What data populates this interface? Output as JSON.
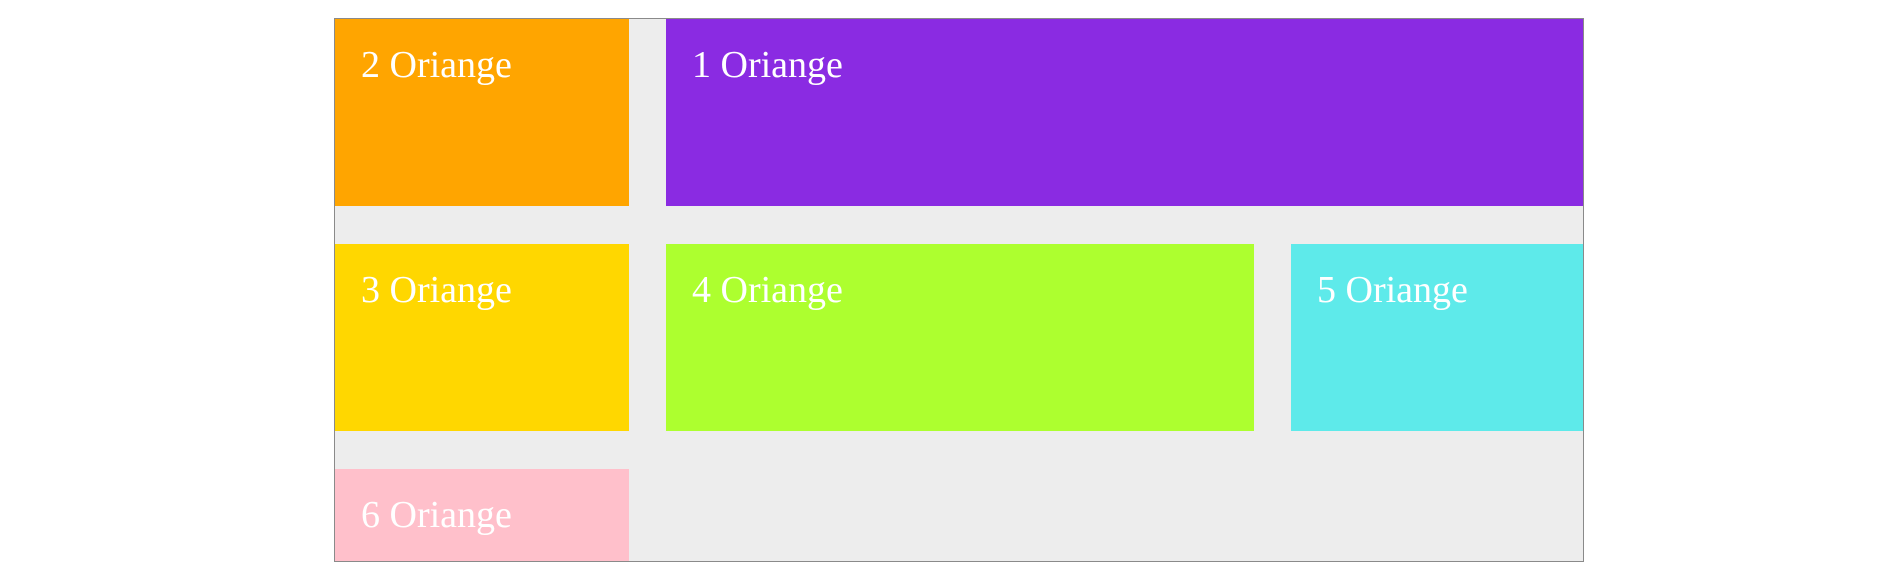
{
  "boxes": [
    {
      "id": "1",
      "label": "1 Oriange",
      "color": "#8a2be2"
    },
    {
      "id": "2",
      "label": "2 Oriange",
      "color": "#ffa500"
    },
    {
      "id": "3",
      "label": "3 Oriange",
      "color": "#ffd700"
    },
    {
      "id": "4",
      "label": "4 Oriange",
      "color": "#adff2f"
    },
    {
      "id": "5",
      "label": "5 Oriange",
      "color": "#5eeaea"
    },
    {
      "id": "6",
      "label": "6 Oriange",
      "color": "#ffc0cb"
    }
  ],
  "container": {
    "background": "#ededed",
    "border": "#8a8a8a"
  }
}
